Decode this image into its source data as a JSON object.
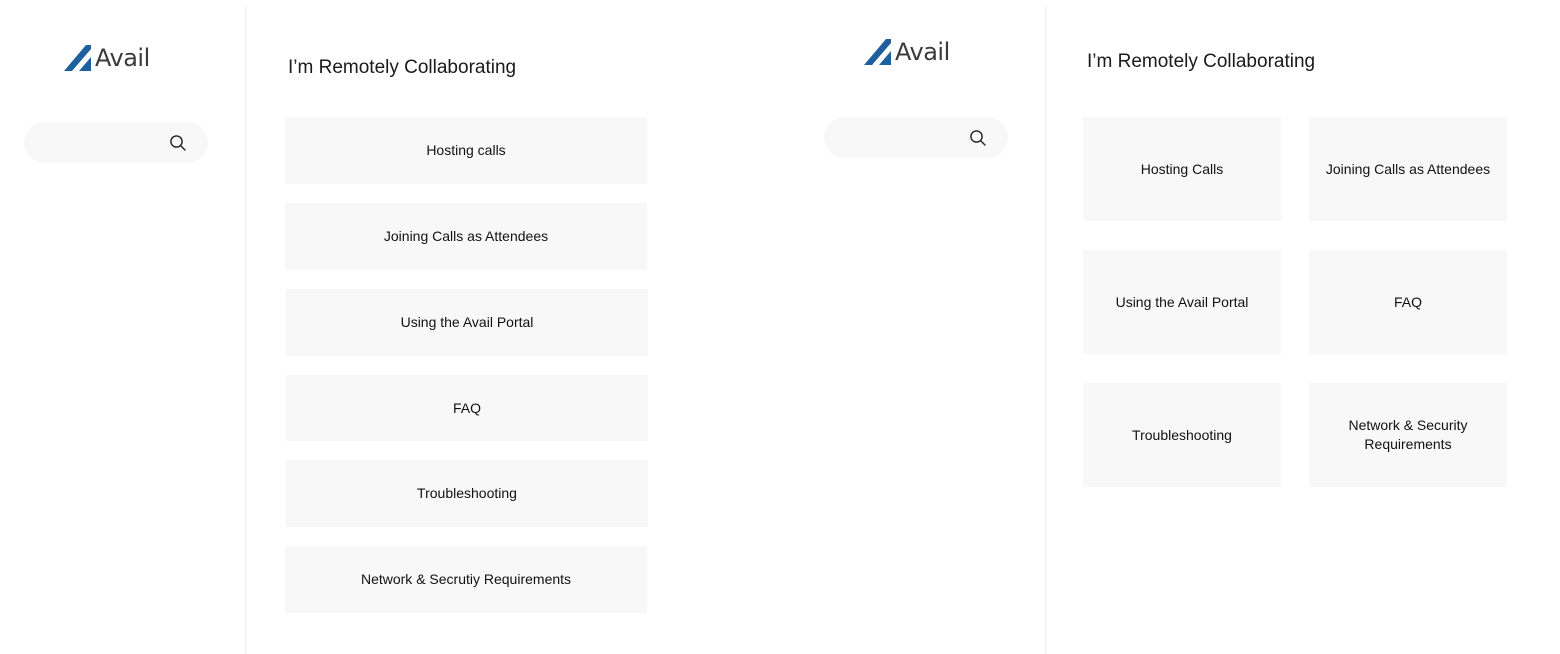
{
  "brand": {
    "name": "Avail",
    "mark_color": "#1e5f9e",
    "text_color": "#3b3b3b"
  },
  "list_view": {
    "search": {
      "placeholder": "",
      "value": "",
      "icon": "search-icon"
    },
    "title": "I’m Remotely Collaborating",
    "items": [
      {
        "label": "Hosting calls"
      },
      {
        "label": "Joining Calls as Attendees"
      },
      {
        "label": "Using the Avail Portal"
      },
      {
        "label": "FAQ"
      },
      {
        "label": "Troubleshooting"
      },
      {
        "label": "Network & Secrutiy Requirements"
      }
    ]
  },
  "grid_view": {
    "search": {
      "placeholder": "",
      "value": "",
      "icon": "search-icon"
    },
    "title": "I’m Remotely Collaborating",
    "items": [
      {
        "label": "Hosting Calls"
      },
      {
        "label": "Joining Calls as Attendees"
      },
      {
        "label": "Using the Avail Portal"
      },
      {
        "label": "FAQ"
      },
      {
        "label": "Troubleshooting"
      },
      {
        "label": "Network & Security Requirements"
      }
    ]
  },
  "colors": {
    "card_background": "#f8f8f8",
    "search_background": "#f8f8f8",
    "divider": "#efefef"
  }
}
